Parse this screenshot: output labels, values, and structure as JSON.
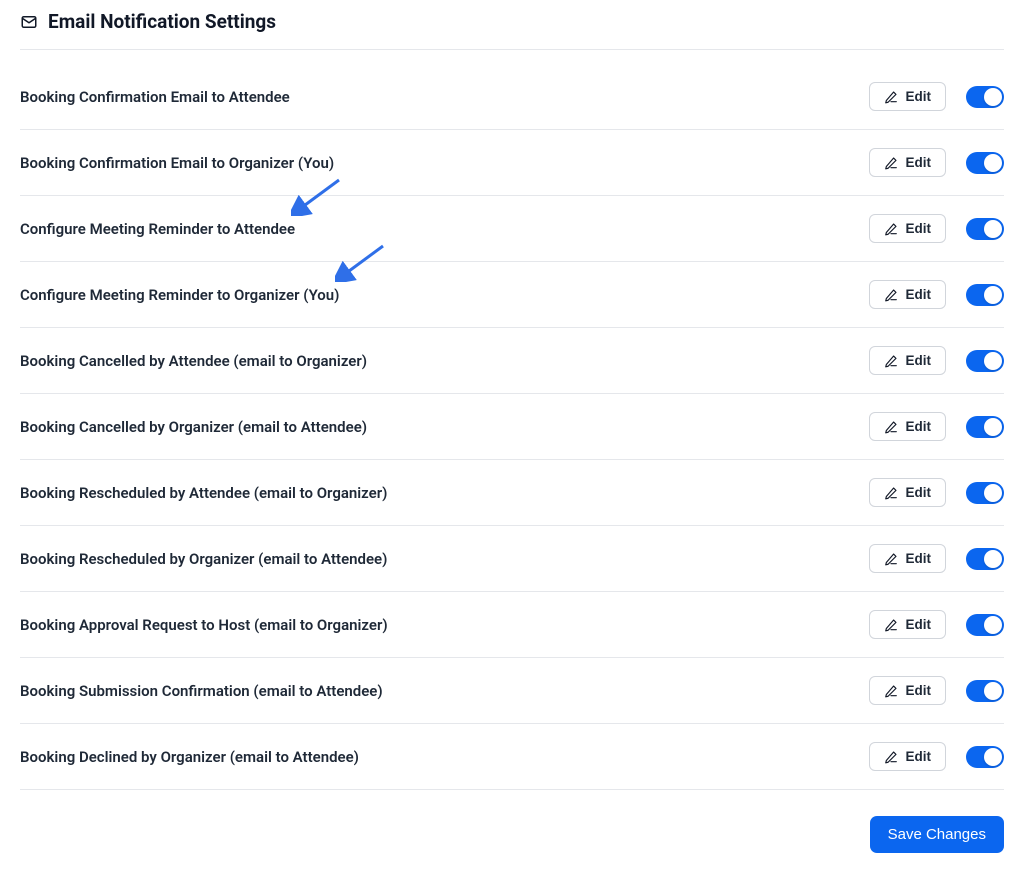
{
  "header": {
    "title": "Email Notification Settings"
  },
  "buttons": {
    "edit": "Edit",
    "save": "Save Changes"
  },
  "settings": [
    {
      "label": "Booking Confirmation Email to Attendee",
      "enabled": true
    },
    {
      "label": "Booking Confirmation Email to Organizer (You)",
      "enabled": true
    },
    {
      "label": "Configure Meeting Reminder to Attendee",
      "enabled": true,
      "arrow": true
    },
    {
      "label": "Configure Meeting Reminder to Organizer (You)",
      "enabled": true,
      "arrow": true
    },
    {
      "label": "Booking Cancelled by Attendee (email to Organizer)",
      "enabled": true
    },
    {
      "label": "Booking Cancelled by Organizer (email to Attendee)",
      "enabled": true
    },
    {
      "label": "Booking Rescheduled by Attendee (email to Organizer)",
      "enabled": true
    },
    {
      "label": "Booking Rescheduled by Organizer (email to Attendee)",
      "enabled": true
    },
    {
      "label": "Booking Approval Request to Host (email to Organizer)",
      "enabled": true
    },
    {
      "label": "Booking Submission Confirmation (email to Attendee)",
      "enabled": true
    },
    {
      "label": "Booking Declined by Organizer (email to Attendee)",
      "enabled": true
    }
  ]
}
